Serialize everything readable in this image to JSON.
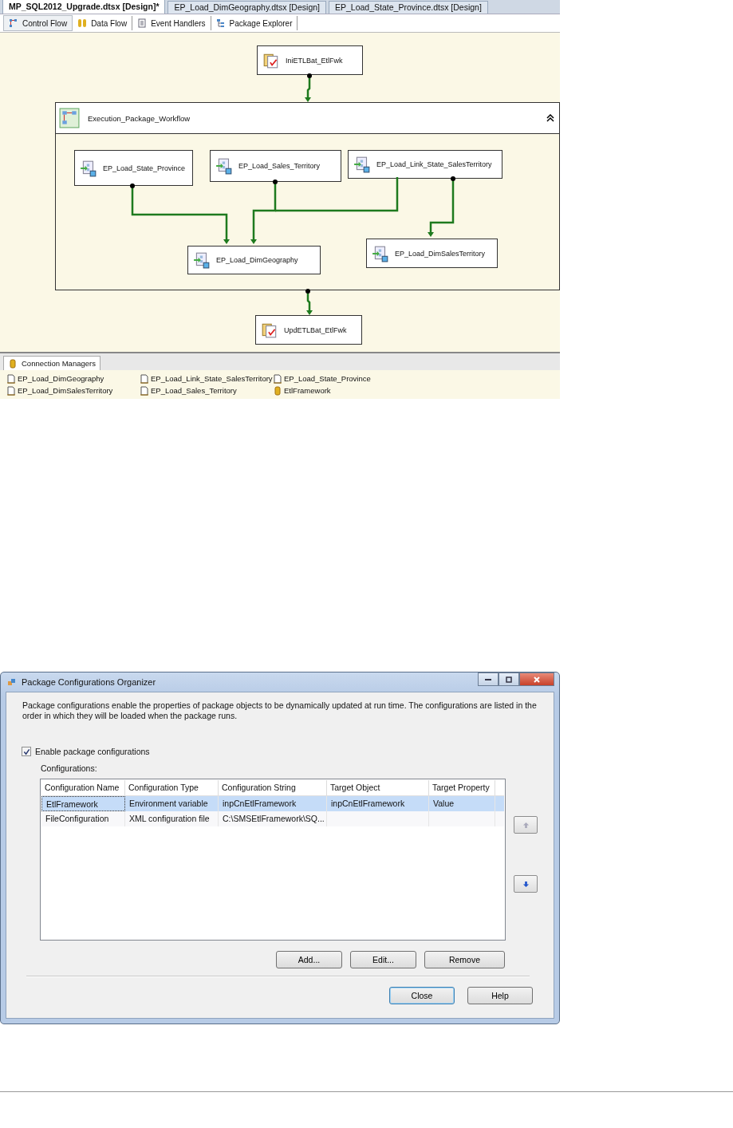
{
  "designer": {
    "document_tabs": [
      {
        "label": "MP_SQL2012_Upgrade.dtsx [Design]*",
        "selected": true
      },
      {
        "label": "EP_Load_DimGeography.dtsx [Design]",
        "selected": false
      },
      {
        "label": "EP_Load_State_Province.dtsx [Design]",
        "selected": false
      }
    ],
    "view_tabs": [
      {
        "label": "Control Flow",
        "kind": "control",
        "selected": true
      },
      {
        "label": "Data Flow",
        "kind": "data",
        "selected": false
      },
      {
        "label": "Event Handlers",
        "kind": "events",
        "selected": false
      },
      {
        "label": "Package Explorer",
        "kind": "explorer",
        "selected": false
      }
    ],
    "diagram": {
      "start_task": {
        "label": "IniETLBat_EtlFwk",
        "kind": "script"
      },
      "container": {
        "title": "Execution_Package_Workflow",
        "expanded": true,
        "tasks": [
          {
            "label": "EP_Load_State_Province",
            "kind": "package"
          },
          {
            "label": "EP_Load_Sales_Territory",
            "kind": "package"
          },
          {
            "label": "EP_Load_Link_State_SalesTerritory",
            "kind": "package"
          },
          {
            "label": "EP_Load_DimGeography",
            "kind": "package"
          },
          {
            "label": "EP_Load_DimSalesTerritory",
            "kind": "package"
          }
        ]
      },
      "end_task": {
        "label": "UpdETLBat_EtlFwk",
        "kind": "script"
      }
    },
    "connection_managers": {
      "tab_label": "Connection Managers",
      "items": [
        {
          "label": "EP_Load_DimGeography",
          "kind": "file"
        },
        {
          "label": "EP_Load_DimSalesTerritory",
          "kind": "file"
        },
        {
          "label": "EP_Load_Link_State_SalesTerritory",
          "kind": "file"
        },
        {
          "label": "EP_Load_Sales_Territory",
          "kind": "file"
        },
        {
          "label": "EP_Load_State_Province",
          "kind": "file"
        },
        {
          "label": "EtlFramework",
          "kind": "database"
        }
      ]
    }
  },
  "dialog": {
    "title": "Package Configurations Organizer",
    "description": "Package configurations enable the properties of package objects to be dynamically updated at run time. The configurations are listed in the order in which they will be loaded when the package runs.",
    "enable_checkbox": {
      "label": "Enable package configurations",
      "checked": true
    },
    "configurations_label": "Configurations:",
    "table": {
      "columns": [
        "Configuration Name",
        "Configuration Type",
        "Configuration String",
        "Target Object",
        "Target Property"
      ],
      "rows": [
        {
          "cells": [
            "EtlFramework",
            "Environment variable",
            "inpCnEtlFramework",
            "inpCnEtlFramework",
            "Value"
          ],
          "selected": true
        },
        {
          "cells": [
            "FileConfiguration",
            "XML configuration file",
            "C:\\SMSEtlFramework\\SQ...",
            "",
            ""
          ],
          "selected": false
        }
      ]
    },
    "list_buttons": [
      "Add...",
      "Edit...",
      "Remove"
    ],
    "footer_buttons": [
      {
        "label": "Close",
        "default": true
      },
      {
        "label": "Help",
        "default": false
      }
    ]
  }
}
